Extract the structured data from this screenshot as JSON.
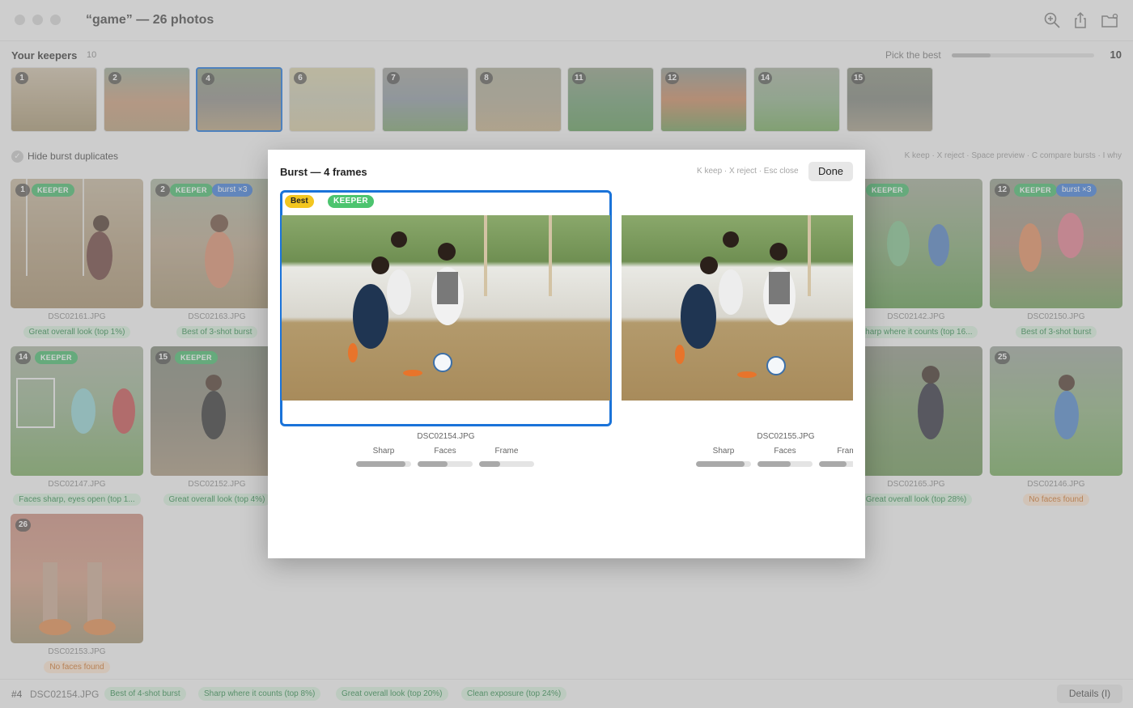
{
  "window": {
    "title": "“game” — 26 photos"
  },
  "keepers": {
    "title": "Your keepers",
    "count": "10",
    "pick_label": "Pick the best",
    "pick_value": "10",
    "thumbs": [
      {
        "num": "1"
      },
      {
        "num": "2"
      },
      {
        "num": "4"
      },
      {
        "num": "6"
      },
      {
        "num": "7"
      },
      {
        "num": "8"
      },
      {
        "num": "11"
      },
      {
        "num": "12"
      },
      {
        "num": "14"
      },
      {
        "num": "15"
      }
    ]
  },
  "filter": {
    "hide_burst_label": "Hide burst duplicates",
    "hints": "K keep · X reject · Space preview · C compare bursts · I why"
  },
  "grid": [
    {
      "num": "1",
      "keeper": "KEEPER",
      "burst": "",
      "file": "DSC02161.JPG",
      "reason": "Great overall look (top 1%)",
      "tone": "good"
    },
    {
      "num": "2",
      "keeper": "KEEPER",
      "burst": "burst ×3",
      "file": "DSC02163.JPG",
      "reason": "Best of 3-shot burst",
      "tone": "good"
    },
    {
      "num": "",
      "keeper": "KEEPER",
      "burst": "",
      "file": "DSC02142.JPG",
      "reason": "Sharp where it counts (top 16...",
      "tone": "good"
    },
    {
      "num": "12",
      "keeper": "KEEPER",
      "burst": "burst ×3",
      "file": "DSC02150.JPG",
      "reason": "Best of 3-shot burst",
      "tone": "good"
    },
    {
      "num": "14",
      "keeper": "KEEPER",
      "burst": "",
      "file": "DSC02147.JPG",
      "reason": "Faces sharp, eyes open (top 1...",
      "tone": "good"
    },
    {
      "num": "15",
      "keeper": "KEEPER",
      "burst": "",
      "file": "DSC02152.JPG",
      "reason": "Great overall look (top 4%)",
      "tone": "good"
    },
    {
      "num": "",
      "keeper": "",
      "burst": "",
      "file": "DSC02165.JPG",
      "reason": "Great overall look (top 28%)",
      "tone": "good"
    },
    {
      "num": "25",
      "keeper": "",
      "burst": "",
      "file": "DSC02146.JPG",
      "reason": "No faces found",
      "tone": "warn"
    },
    {
      "num": "26",
      "keeper": "",
      "burst": "",
      "file": "DSC02153.JPG",
      "reason": "No faces found",
      "tone": "warn"
    }
  ],
  "modal": {
    "title": "Burst — 4 frames",
    "hints": "K keep · X reject · Esc close",
    "done_label": "Done",
    "frames": [
      {
        "best_label": "Best",
        "keeper_label": "KEEPER",
        "file": "DSC02154.JPG",
        "metrics": [
          {
            "label": "Sharp",
            "value": 0.9
          },
          {
            "label": "Faces",
            "value": 0.55
          },
          {
            "label": "Frame",
            "value": 0.38
          }
        ]
      },
      {
        "file": "DSC02155.JPG",
        "metrics": [
          {
            "label": "Sharp",
            "value": 0.88
          },
          {
            "label": "Faces",
            "value": 0.6
          },
          {
            "label": "Fram",
            "value": 0.5
          }
        ]
      }
    ]
  },
  "status": {
    "index": "#4",
    "file": "DSC02154.JPG",
    "chips": [
      "Best of 4-shot burst",
      "Sharp where it counts (top 8%)",
      "Great overall look (top 20%)",
      "Clean exposure (top 24%)"
    ],
    "details_label": "Details (I)"
  }
}
